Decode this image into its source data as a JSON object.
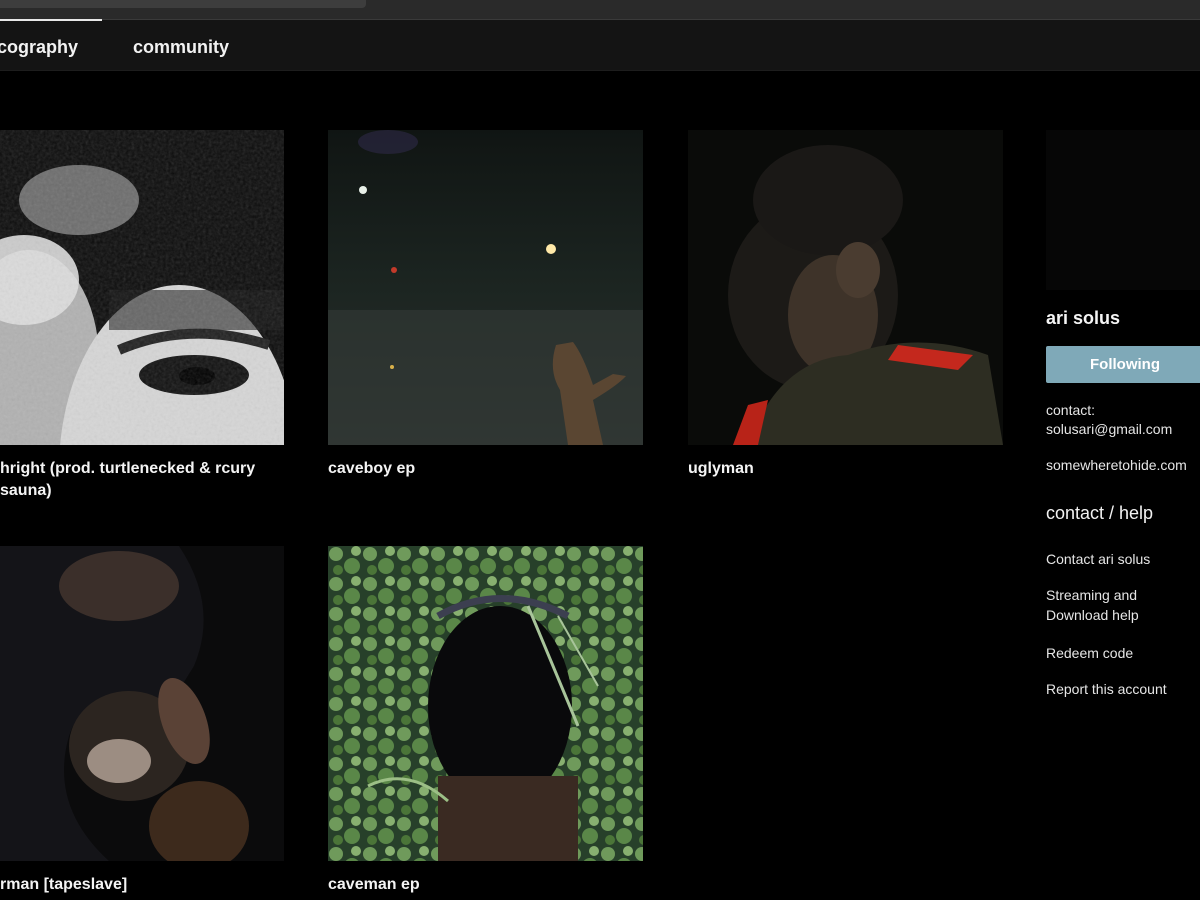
{
  "nav": {
    "tabs": [
      {
        "label": "discography"
      },
      {
        "label": "community"
      }
    ]
  },
  "albums": [
    {
      "title": "rightright (prod. turtlenecked & mercury sauna)",
      "visible_title": "hright (prod. turtlenecked & rcury sauna)"
    },
    {
      "title": "caveboy ep"
    },
    {
      "title": "uglyman"
    },
    {
      "title": "rman [tapeslave]"
    },
    {
      "title": "caveman ep"
    }
  ],
  "artist": {
    "name": "ari solus",
    "follow_label": "Following",
    "contact_label": "contact:",
    "contact_email": "solusari@gmail.com",
    "website": "somewheretohide.com"
  },
  "help": {
    "heading": "contact / help",
    "links": [
      "Contact ari solus",
      "Streaming and",
      "Download help",
      "Redeem code",
      "Report this account"
    ]
  },
  "colors": {
    "background": "#000000",
    "nav_background": "#141414",
    "follow_button": "#7fa9b8"
  }
}
